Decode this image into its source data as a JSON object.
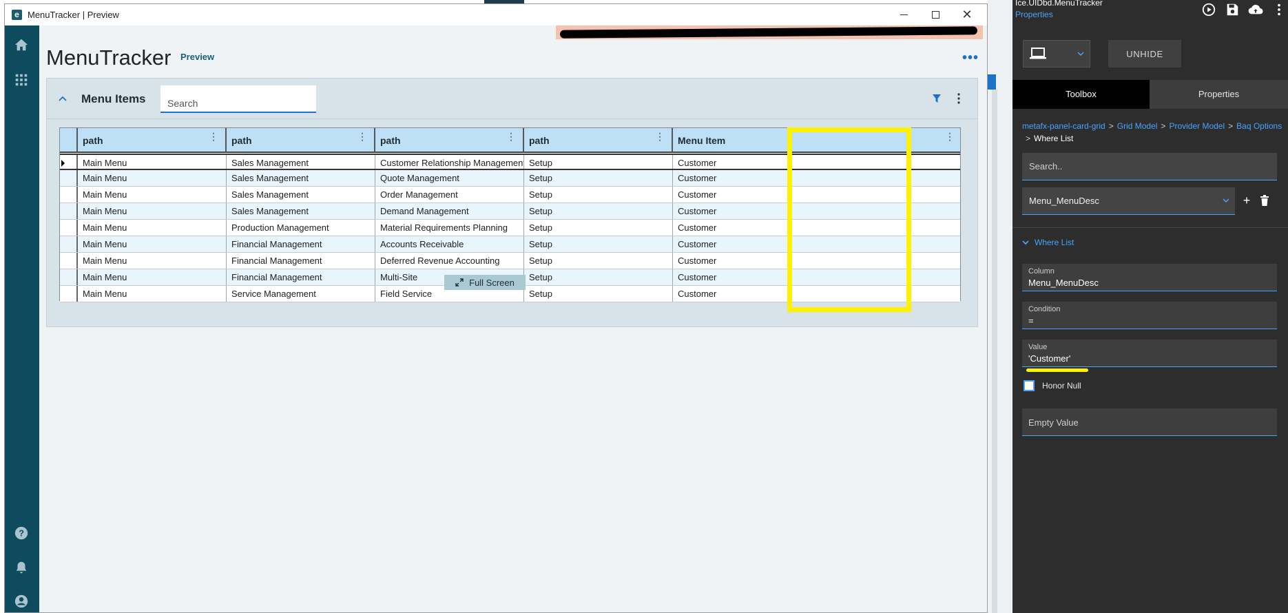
{
  "window": {
    "title": "MenuTracker | Preview",
    "logo_letter": "e"
  },
  "app": {
    "title": "MenuTracker",
    "badge": "Preview"
  },
  "panel": {
    "title": "Menu Items",
    "search_placeholder": "Search",
    "full_screen_label": "Full Screen"
  },
  "grid": {
    "columns": [
      "path",
      "path",
      "path",
      "path",
      "Menu Item"
    ],
    "rows": [
      [
        "Main Menu",
        "Sales Management",
        "Customer Relationship Management",
        "Setup",
        "Customer"
      ],
      [
        "Main Menu",
        "Sales Management",
        "Quote Management",
        "Setup",
        "Customer"
      ],
      [
        "Main Menu",
        "Sales Management",
        "Order Management",
        "Setup",
        "Customer"
      ],
      [
        "Main Menu",
        "Sales Management",
        "Demand Management",
        "Setup",
        "Customer"
      ],
      [
        "Main Menu",
        "Production Management",
        "Material Requirements Planning",
        "Setup",
        "Customer"
      ],
      [
        "Main Menu",
        "Financial Management",
        "Accounts Receivable",
        "Setup",
        "Customer"
      ],
      [
        "Main Menu",
        "Financial Management",
        "Deferred Revenue Accounting",
        "Setup",
        "Customer"
      ],
      [
        "Main Menu",
        "Financial Management",
        "Multi-Site",
        "Setup",
        "Customer"
      ],
      [
        "Main Menu",
        "Service Management",
        "Field Service",
        "Setup",
        "Customer"
      ]
    ]
  },
  "designer": {
    "path": "Ice.UIDbd.MenuTracker",
    "properties_link": "Properties",
    "unhide_label": "UNHIDE",
    "tabs": [
      "Toolbox",
      "Properties"
    ],
    "breadcrumb": [
      "metafx-panel-card-grid",
      "Grid Model",
      "Provider Model",
      "Baq Options"
    ],
    "breadcrumb_current": "Where List",
    "breadcrumb_sep": ">",
    "search_placeholder": "Search..",
    "where_select_value": "Menu_MenuDesc",
    "add_label": "+",
    "section_title": "Where List",
    "fields": {
      "column": {
        "label": "Column",
        "value": "Menu_MenuDesc"
      },
      "condition": {
        "label": "Condition",
        "value": "="
      },
      "value": {
        "label": "Value",
        "value": "'Customer'"
      },
      "empty": {
        "label": "Empty Value",
        "value": ""
      }
    },
    "honor_null_label": "Honor Null"
  },
  "colors": {
    "nav_bg": "#0f4b5e",
    "accent_blue": "#1a73c8",
    "highlight_yellow": "#fff200",
    "designer_bg": "#2d2d2d"
  }
}
